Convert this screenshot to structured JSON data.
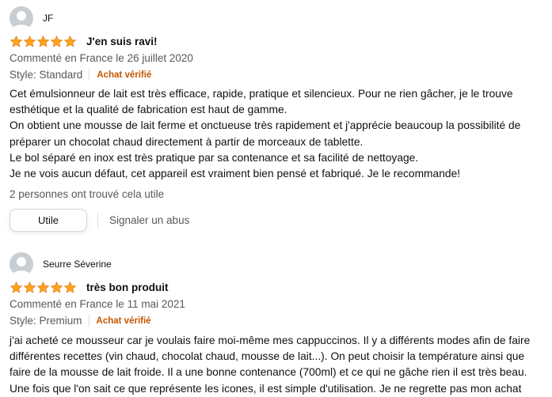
{
  "reviews": [
    {
      "username": "JF",
      "rating": 5,
      "title": "J'en suis ravi!",
      "date": "Commenté en France le 26 juillet 2020",
      "style": "Style: Standard",
      "verified": "Achat vérifié",
      "body": [
        "Cet émulsionneur de lait est très efficace, rapide, pratique et silencieux. Pour ne rien gâcher, je le trouve esthétique et la qualité de fabrication est haut de gamme.",
        "On obtient une mousse de lait ferme et onctueuse très rapidement et j'apprécie beaucoup la possibilité de préparer un chocolat chaud directement à partir de morceaux de tablette.",
        "Le bol séparé en inox est très pratique par sa contenance et sa facilité de nettoyage.",
        "Je ne vois aucun défaut, cet appareil est vraiment bien pensé et fabriqué. Je le recommande!"
      ],
      "helpful": "2 personnes ont trouvé cela utile",
      "useful_button": "Utile",
      "report_link": "Signaler un abus"
    },
    {
      "username": "Seurre Séverine",
      "rating": 5,
      "title": "très bon produit",
      "date": "Commenté en France le 11 mai 2021",
      "style": "Style: Premium",
      "verified": "Achat vérifié",
      "body": [
        "j'ai acheté ce mousseur car je voulais faire moi-même mes cappuccinos. Il y a différents modes afin de faire différentes recettes (vin chaud, chocolat chaud, mousse de lait...). On peut choisir la température ainsi que faire de la mousse de lait froide. Il a une bonne contenance (700ml) et ce qui ne gâche rien il est très beau. Une fois que l'on sait ce que représente les icones, il est simple d'utilisation. Je ne regrette pas mon achat"
      ]
    }
  ],
  "colors": {
    "star": "#ffa41c",
    "star_edge": "#de7921",
    "verified": "#c45500",
    "muted": "#565959"
  }
}
